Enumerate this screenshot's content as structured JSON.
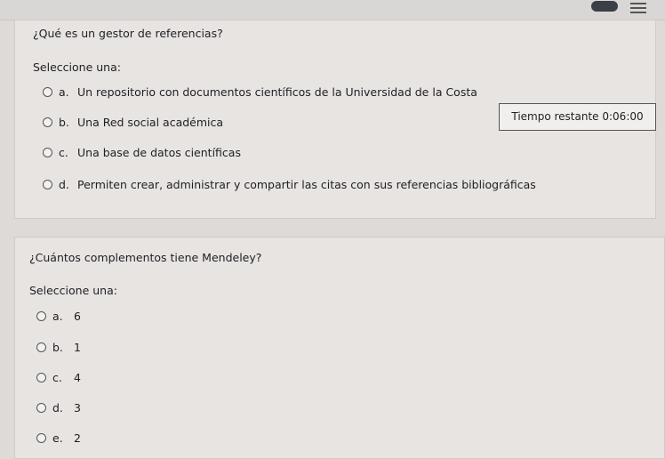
{
  "q1": {
    "question": "¿Qué es un gestor de referencias?",
    "prompt": "Seleccione una:",
    "options": [
      {
        "letter": "a.",
        "text": "Un repositorio con documentos científicos de la Universidad de la Costa"
      },
      {
        "letter": "b.",
        "text": "Una Red social académica"
      },
      {
        "letter": "c.",
        "text": "Una base de datos científicas"
      },
      {
        "letter": "d.",
        "text": "Permiten crear, administrar y compartir las citas con sus referencias bibliográficas"
      }
    ]
  },
  "timer": {
    "label": "Tiempo restante 0:06:00"
  },
  "q2": {
    "question": "¿Cuántos complementos tiene Mendeley?",
    "prompt": "Seleccione una:",
    "options": [
      {
        "letter": "a.",
        "text": "6"
      },
      {
        "letter": "b.",
        "text": "1"
      },
      {
        "letter": "c.",
        "text": "4"
      },
      {
        "letter": "d.",
        "text": "3"
      },
      {
        "letter": "e.",
        "text": "2"
      }
    ]
  },
  "colors": {
    "background": "#dedad7",
    "card": "#e7e4e2",
    "text": "#1f1f22"
  }
}
